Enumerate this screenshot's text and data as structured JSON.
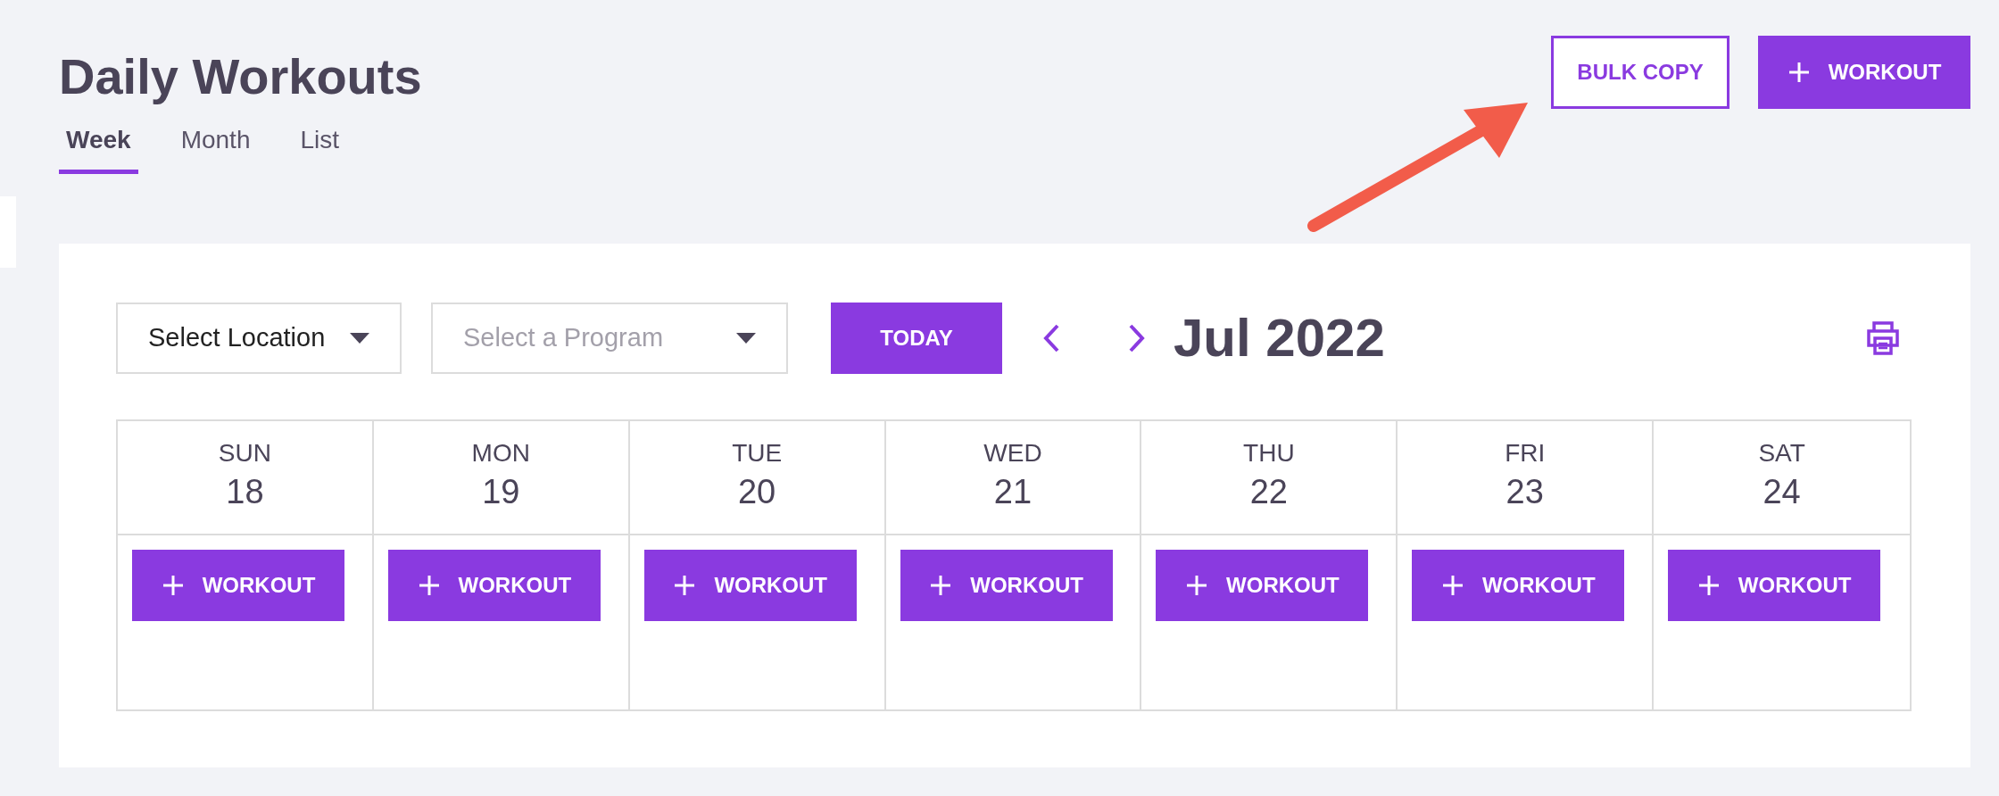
{
  "title": "Daily Workouts",
  "tabs": [
    {
      "label": "Week",
      "selected": true
    },
    {
      "label": "Month",
      "selected": false
    },
    {
      "label": "List",
      "selected": false
    }
  ],
  "header_buttons": [
    {
      "kind": "outline",
      "label": "BULK COPY"
    },
    {
      "kind": "add",
      "label": "WORKOUT"
    }
  ],
  "filters": [
    {
      "value": "Select Location"
    },
    {
      "placeholder": "Select a Program"
    }
  ],
  "today_button": "TODAY",
  "period": "Jul 2022",
  "days": [
    {
      "name": "SUN",
      "date": "18",
      "button": "WORKOUT"
    },
    {
      "name": "MON",
      "date": "19",
      "button": "WORKOUT"
    },
    {
      "name": "TUE",
      "date": "20",
      "button": "WORKOUT"
    },
    {
      "name": "WED",
      "date": "21",
      "button": "WORKOUT"
    },
    {
      "name": "THU",
      "date": "22",
      "button": "WORKOUT"
    },
    {
      "name": "FRI",
      "date": "23",
      "button": "WORKOUT"
    },
    {
      "name": "SAT",
      "date": "24",
      "button": "WORKOUT"
    }
  ]
}
